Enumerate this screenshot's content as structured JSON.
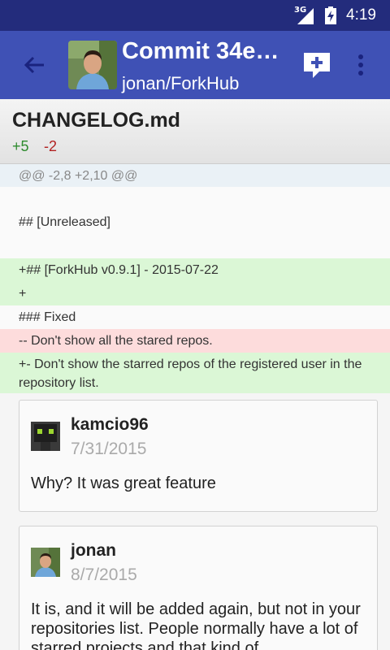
{
  "status_bar": {
    "network": "3G",
    "time": "4:19"
  },
  "app_bar": {
    "title": "Commit 34e…",
    "subtitle": "jonan/ForkHub"
  },
  "file": {
    "name": "CHANGELOG.md",
    "additions": "+5",
    "deletions": "-2"
  },
  "diff_lines": [
    {
      "type": "hunk",
      "text": "@@ -2,8 +2,10 @@"
    },
    {
      "type": "ctx",
      "text": ""
    },
    {
      "type": "ctx",
      "text": " ## [Unreleased]"
    },
    {
      "type": "ctx",
      "text": ""
    },
    {
      "type": "add",
      "text": "+## [ForkHub v0.9.1] - 2015-07-22"
    },
    {
      "type": "add",
      "text": "+"
    },
    {
      "type": "ctx",
      "text": " ### Fixed"
    },
    {
      "type": "del",
      "text": "-- Don't show all the stared repos."
    },
    {
      "type": "add",
      "text": "+- Don't show the starred repos of the registered user in the repository list."
    }
  ],
  "comments": [
    {
      "author": "kamcio96",
      "date": "7/31/2015",
      "body": "Why? It was great feature"
    },
    {
      "author": "jonan",
      "date": "8/7/2015",
      "body": "It is, and it will be added again, but not in your repositories list. People normally have a lot of starred projects and that kind of"
    }
  ],
  "colors": {
    "status_bar": "#232c7c",
    "app_bar": "#3f51b5",
    "added_bg": "#dbf7d6",
    "removed_bg": "#fddcdc",
    "hunk_bg": "#eaf1f6"
  },
  "icons": {
    "back": "arrow-back-icon",
    "add_comment": "add-comment-icon",
    "overflow": "more-vert-icon"
  }
}
